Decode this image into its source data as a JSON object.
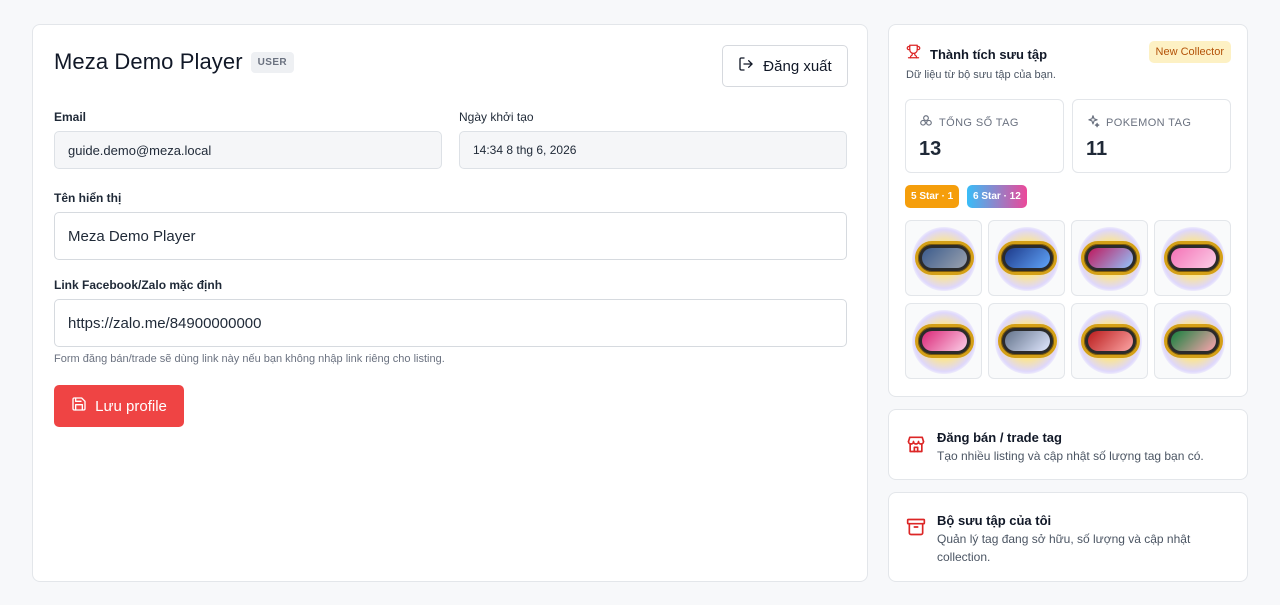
{
  "profile": {
    "name": "Meza Demo Player",
    "role": "USER",
    "logout_label": "Đăng xuất",
    "email_label": "Email",
    "email_value": "guide.demo@meza.local",
    "created_label": "Ngày khởi tạo",
    "created_value": "14:34 8 thg 6, 2026",
    "display_name_label": "Tên hiển thị",
    "display_name_value": "Meza Demo Player",
    "link_label": "Link Facebook/Zalo mặc định",
    "link_value": "https://zalo.me/84900000000",
    "link_help": "Form đăng bán/trade sẽ dùng link này nếu bạn không nhập link riêng cho listing.",
    "save_label": "Lưu profile"
  },
  "achievements": {
    "title": "Thành tích sưu tập",
    "subtitle": "Dữ liệu từ bộ sưu tập của bạn.",
    "badge": "New Collector",
    "total_label": "TỔNG SỐ TAG",
    "total_value": "13",
    "pokemon_label": "POKEMON TAG",
    "pokemon_value": "11",
    "chips": [
      {
        "label": "5 Star · 1",
        "color": "#f59e0b"
      },
      {
        "label": "6 Star · 12",
        "color_from": "#38bdf8",
        "color_to": "#ec4899"
      }
    ],
    "tags": [
      {
        "name": "tag-1",
        "colors": [
          "#3b5b8c",
          "#9ca3af"
        ]
      },
      {
        "name": "tag-2",
        "colors": [
          "#1e3a8a",
          "#60a5fa"
        ]
      },
      {
        "name": "tag-3",
        "colors": [
          "#be185d",
          "#93c5fd"
        ]
      },
      {
        "name": "tag-4",
        "colors": [
          "#f472b6",
          "#fbcfe8"
        ]
      },
      {
        "name": "tag-5",
        "colors": [
          "#db2777",
          "#fbcfe8"
        ]
      },
      {
        "name": "tag-6",
        "colors": [
          "#64748b",
          "#e0e7ff"
        ]
      },
      {
        "name": "tag-7",
        "colors": [
          "#b91c1c",
          "#fca5a5"
        ]
      },
      {
        "name": "tag-8",
        "colors": [
          "#15803d",
          "#fda4af"
        ]
      }
    ]
  },
  "links": {
    "sell_title": "Đăng bán / trade tag",
    "sell_desc": "Tạo nhiều listing và cập nhật số lượng tag bạn có.",
    "collection_title": "Bộ sưu tập của tôi",
    "collection_desc": "Quản lý tag đang sở hữu, số lượng và cập nhật collection."
  },
  "colors": {
    "accent_red": "#ef4444",
    "badge_bg": "#fdf1c4",
    "badge_text": "#b45309"
  }
}
